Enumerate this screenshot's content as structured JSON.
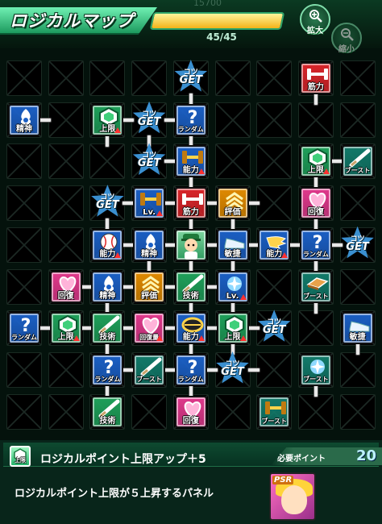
{
  "header": {
    "title": "ロジカルマップ",
    "points_text": "45/45",
    "points_fraction": 1.0,
    "ghost_number": "15700",
    "zoom_in": {
      "label": "拡大",
      "icon": "zoom-in-icon"
    },
    "zoom_out": {
      "label": "縮小",
      "icon": "zoom-out-icon"
    }
  },
  "grid_cols": 9,
  "grid_rows": 9,
  "panels": [
    {
      "r": 0,
      "c": 4,
      "type": "star",
      "k1": "コツ",
      "k2": "GET"
    },
    {
      "r": 0,
      "c": 7,
      "type": "panel",
      "label": "筋力",
      "color": "#d9252a",
      "icon": "dumbbell-icon"
    },
    {
      "r": 1,
      "c": 0,
      "type": "panel",
      "label": "精神",
      "color": "#1b5fc4",
      "icon": "spirit-icon"
    },
    {
      "r": 1,
      "c": 2,
      "type": "panel",
      "label": "上限",
      "color": "#1fa05a",
      "icon": "hexagon-icon",
      "arrow": true
    },
    {
      "r": 1,
      "c": 3,
      "type": "star",
      "k1": "コツ",
      "k2": "GET"
    },
    {
      "r": 1,
      "c": 4,
      "type": "panel",
      "label": "ランダム",
      "color": "#1b5fc4",
      "icon": "question-icon",
      "small": true
    },
    {
      "r": 2,
      "c": 3,
      "type": "star",
      "k1": "コツ",
      "k2": "GET"
    },
    {
      "r": 2,
      "c": 4,
      "type": "panel",
      "label": "能力",
      "color": "#1b5fc4",
      "icon": "dumbbell-gold-icon",
      "arrow": true
    },
    {
      "r": 2,
      "c": 7,
      "type": "panel",
      "label": "上限",
      "color": "#1fa05a",
      "icon": "hexagon-icon",
      "arrow": true
    },
    {
      "r": 2,
      "c": 8,
      "type": "panel",
      "label": "ブースト",
      "color": "#127a6a",
      "icon": "bat-icon",
      "small": true
    },
    {
      "r": 3,
      "c": 2,
      "type": "star",
      "k1": "コツ",
      "k2": "GET"
    },
    {
      "r": 3,
      "c": 3,
      "type": "panel",
      "label": "Lv.",
      "color": "#1b5fc4",
      "icon": "dumbbell-gold-icon",
      "arrow": true
    },
    {
      "r": 3,
      "c": 4,
      "type": "panel",
      "label": "筋力",
      "color": "#d9252a",
      "icon": "dumbbell-icon"
    },
    {
      "r": 3,
      "c": 5,
      "type": "panel",
      "label": "評価",
      "color": "#e08a00",
      "icon": "chevrons-icon"
    },
    {
      "r": 3,
      "c": 7,
      "type": "panel",
      "label": "回復",
      "color": "#e0398c",
      "icon": "heart-icon"
    },
    {
      "r": 4,
      "c": 2,
      "type": "panel",
      "label": "能力",
      "color": "#1b5fc4",
      "icon": "ball-icon",
      "arrow": true
    },
    {
      "r": 4,
      "c": 3,
      "type": "panel",
      "label": "精神",
      "color": "#1b5fc4",
      "icon": "spirit-icon"
    },
    {
      "r": 4,
      "c": 4,
      "type": "player"
    },
    {
      "r": 4,
      "c": 5,
      "type": "panel",
      "label": "敏捷",
      "color": "#1b5fc4",
      "icon": "shoe-icon"
    },
    {
      "r": 4,
      "c": 6,
      "type": "panel",
      "label": "能力",
      "color": "#1b5fc4",
      "icon": "wing-icon",
      "arrow": true
    },
    {
      "r": 4,
      "c": 7,
      "type": "panel",
      "label": "ランダム",
      "color": "#1b5fc4",
      "icon": "question-icon",
      "small": true
    },
    {
      "r": 4,
      "c": 8,
      "type": "star",
      "k1": "コツ",
      "k2": "GET"
    },
    {
      "r": 5,
      "c": 1,
      "type": "panel",
      "label": "回復",
      "color": "#e0398c",
      "icon": "heart-icon"
    },
    {
      "r": 5,
      "c": 2,
      "type": "panel",
      "label": "精神",
      "color": "#1b5fc4",
      "icon": "spirit-icon"
    },
    {
      "r": 5,
      "c": 3,
      "type": "panel",
      "label": "評価",
      "color": "#e08a00",
      "icon": "chevrons-icon"
    },
    {
      "r": 5,
      "c": 4,
      "type": "panel",
      "label": "技術",
      "color": "#1fa05a",
      "icon": "bat-icon"
    },
    {
      "r": 5,
      "c": 5,
      "type": "panel",
      "label": "Lv.",
      "color": "#1b5fc4",
      "icon": "sparkle-icon",
      "arrow": true
    },
    {
      "r": 5,
      "c": 7,
      "type": "panel",
      "label": "ブースト",
      "color": "#127a6a",
      "icon": "plate-icon",
      "small": true
    },
    {
      "r": 6,
      "c": 0,
      "type": "panel",
      "label": "ランダム",
      "color": "#1b5fc4",
      "icon": "question-icon",
      "small": true
    },
    {
      "r": 6,
      "c": 1,
      "type": "panel",
      "label": "上限",
      "color": "#1fa05a",
      "icon": "hexagon-icon",
      "arrow": true
    },
    {
      "r": 6,
      "c": 2,
      "type": "panel",
      "label": "技術",
      "color": "#1fa05a",
      "icon": "bat-icon"
    },
    {
      "r": 6,
      "c": 3,
      "type": "panel",
      "label": "回復量",
      "color": "#e0398c",
      "icon": "heart-icon",
      "arrow": true,
      "small": true
    },
    {
      "r": 6,
      "c": 4,
      "type": "panel",
      "label": "能力",
      "color": "#1b5fc4",
      "icon": "lens-icon",
      "arrow": true
    },
    {
      "r": 6,
      "c": 5,
      "type": "panel",
      "label": "上限",
      "color": "#1fa05a",
      "icon": "hexagon-icon",
      "arrow": true
    },
    {
      "r": 6,
      "c": 6,
      "type": "star",
      "k1": "コツ",
      "k2": "GET"
    },
    {
      "r": 6,
      "c": 8,
      "type": "panel",
      "label": "敏捷",
      "color": "#1b5fc4",
      "icon": "shoe-icon"
    },
    {
      "r": 7,
      "c": 2,
      "type": "panel",
      "label": "ランダム",
      "color": "#1b5fc4",
      "icon": "question-icon",
      "small": true
    },
    {
      "r": 7,
      "c": 3,
      "type": "panel",
      "label": "ブースト",
      "color": "#127a6a",
      "icon": "bat-icon",
      "small": true
    },
    {
      "r": 7,
      "c": 4,
      "type": "panel",
      "label": "ランダム",
      "color": "#1b5fc4",
      "icon": "question-icon",
      "small": true
    },
    {
      "r": 7,
      "c": 5,
      "type": "star",
      "k1": "コツ",
      "k2": "GET"
    },
    {
      "r": 7,
      "c": 7,
      "type": "panel",
      "label": "ブースト",
      "color": "#127a6a",
      "icon": "sparkle-icon",
      "small": true
    },
    {
      "r": 8,
      "c": 2,
      "type": "panel",
      "label": "技術",
      "color": "#1fa05a",
      "icon": "bat-icon"
    },
    {
      "r": 8,
      "c": 4,
      "type": "panel",
      "label": "回復",
      "color": "#e0398c",
      "icon": "heart-icon"
    },
    {
      "r": 8,
      "c": 6,
      "type": "panel",
      "label": "ブースト",
      "color": "#127a6a",
      "icon": "dumbbell-gold-icon",
      "small": true
    }
  ],
  "links_h": [
    [
      1,
      0
    ],
    [
      1,
      2
    ],
    [
      1,
      3
    ],
    [
      2,
      3
    ],
    [
      2,
      7
    ],
    [
      3,
      2
    ],
    [
      3,
      3
    ],
    [
      3,
      4
    ],
    [
      3,
      5
    ],
    [
      4,
      2
    ],
    [
      4,
      3
    ],
    [
      4,
      4
    ],
    [
      4,
      5
    ],
    [
      4,
      6
    ],
    [
      4,
      7
    ],
    [
      5,
      1
    ],
    [
      5,
      2
    ],
    [
      5,
      3
    ],
    [
      5,
      4
    ],
    [
      6,
      0
    ],
    [
      6,
      1
    ],
    [
      6,
      2
    ],
    [
      6,
      3
    ],
    [
      6,
      4
    ],
    [
      6,
      5
    ],
    [
      7,
      2
    ],
    [
      7,
      3
    ],
    [
      7,
      4
    ],
    [
      7,
      5
    ]
  ],
  "links_v": [
    [
      0,
      4
    ],
    [
      0,
      7
    ],
    [
      1,
      2
    ],
    [
      1,
      3
    ],
    [
      1,
      4
    ],
    [
      2,
      4
    ],
    [
      2,
      7
    ],
    [
      3,
      2
    ],
    [
      3,
      4
    ],
    [
      3,
      5
    ],
    [
      3,
      7
    ],
    [
      4,
      3
    ],
    [
      4,
      4
    ],
    [
      4,
      5
    ],
    [
      4,
      7
    ],
    [
      5,
      2
    ],
    [
      5,
      4
    ],
    [
      5,
      5
    ],
    [
      5,
      7
    ],
    [
      6,
      2
    ],
    [
      6,
      4
    ],
    [
      6,
      5
    ],
    [
      6,
      8
    ],
    [
      7,
      2
    ],
    [
      7,
      4
    ],
    [
      7,
      7
    ]
  ],
  "info": {
    "name": "ロジカルポイント上限アップ＋5",
    "required_label": "必要ポイント",
    "required_value": "20",
    "description": "ロジカルポイント上限が５上昇するパネル",
    "char_tag": "PSR",
    "icon": "hexagon-icon",
    "icon_label": "上限"
  }
}
